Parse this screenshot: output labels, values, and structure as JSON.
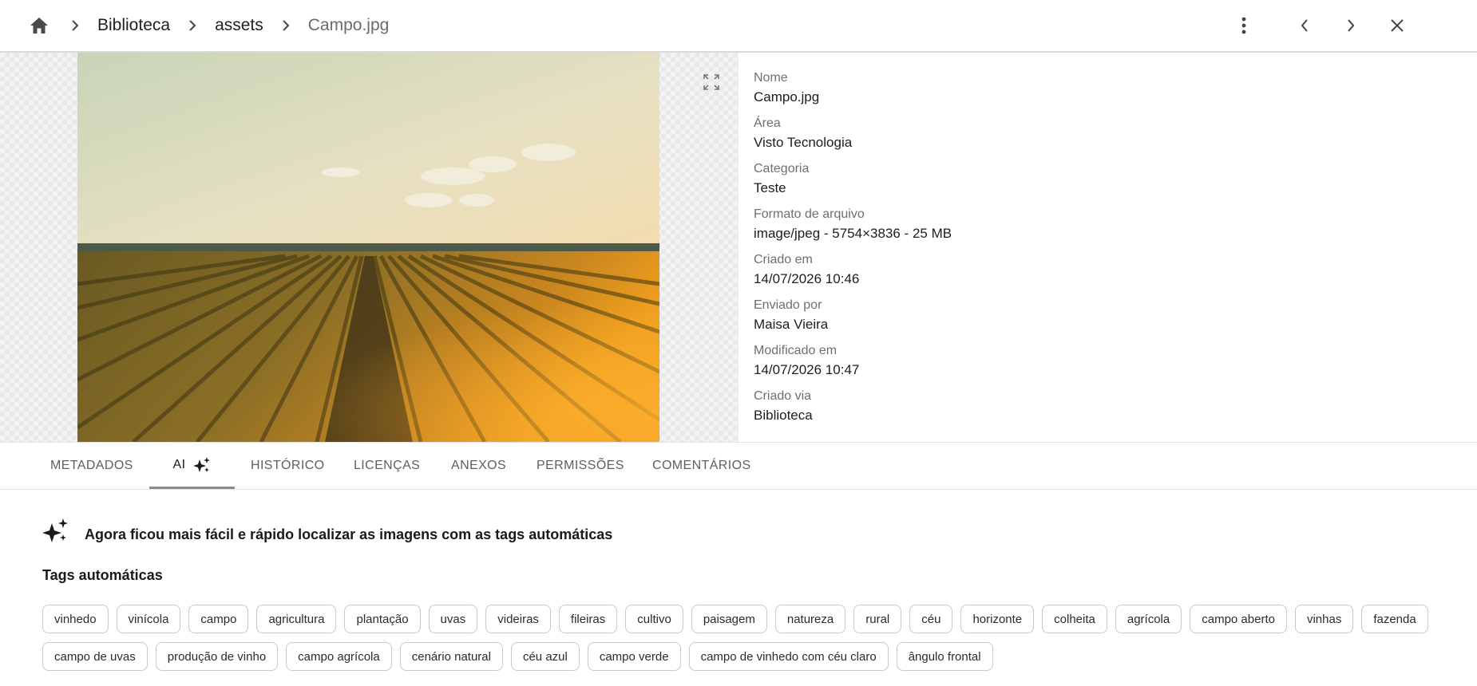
{
  "breadcrumb": {
    "items": [
      "Biblioteca",
      "assets"
    ],
    "current": "Campo.jpg"
  },
  "icons": {
    "home": "home-icon",
    "separator": "chevron-right-icon",
    "more": "more-vertical-icon",
    "previous": "chevron-left-icon",
    "next": "chevron-right-icon",
    "close": "close-icon",
    "expand": "expand-icon",
    "ai": "sparkle-icon"
  },
  "details": {
    "fields": [
      {
        "label": "Nome",
        "value": "Campo.jpg"
      },
      {
        "label": "Área",
        "value": "Visto Tecnologia"
      },
      {
        "label": "Categoria",
        "value": "Teste"
      },
      {
        "label": "Formato de arquivo",
        "value": "image/jpeg - 5754×3836 - 25 MB"
      },
      {
        "label": "Criado em",
        "value": "14/07/2026 10:46"
      },
      {
        "label": "Enviado por",
        "value": "Maisa Vieira"
      },
      {
        "label": "Modificado em",
        "value": "14/07/2026 10:47"
      },
      {
        "label": "Criado via",
        "value": "Biblioteca"
      }
    ]
  },
  "tabs": [
    {
      "label": "METADADOS",
      "active": false
    },
    {
      "label": "AI",
      "active": true
    },
    {
      "label": "HISTÓRICO",
      "active": false
    },
    {
      "label": "LICENÇAS",
      "active": false
    },
    {
      "label": "ANEXOS",
      "active": false
    },
    {
      "label": "PERMISSÕES",
      "active": false
    },
    {
      "label": "COMENTÁRIOS",
      "active": false
    }
  ],
  "ai": {
    "banner": "Agora ficou mais fácil e rápido localizar as imagens com as tags automáticas",
    "tags_title": "Tags automáticas",
    "tags": [
      "vinhedo",
      "vinícola",
      "campo",
      "agricultura",
      "plantação",
      "uvas",
      "videiras",
      "fileiras",
      "cultivo",
      "paisagem",
      "natureza",
      "rural",
      "céu",
      "horizonte",
      "colheita",
      "agrícola",
      "campo aberto",
      "vinhas",
      "fazenda",
      "campo de uvas",
      "produção de vinho",
      "campo agrícola",
      "cenário natural",
      "céu azul",
      "campo verde",
      "campo de vinhedo com céu claro",
      "ângulo frontal"
    ]
  },
  "colors": {
    "accent_underline": "#8a8a8a",
    "border": "#d9d9d9",
    "text_secondary": "#6f6f6f"
  }
}
